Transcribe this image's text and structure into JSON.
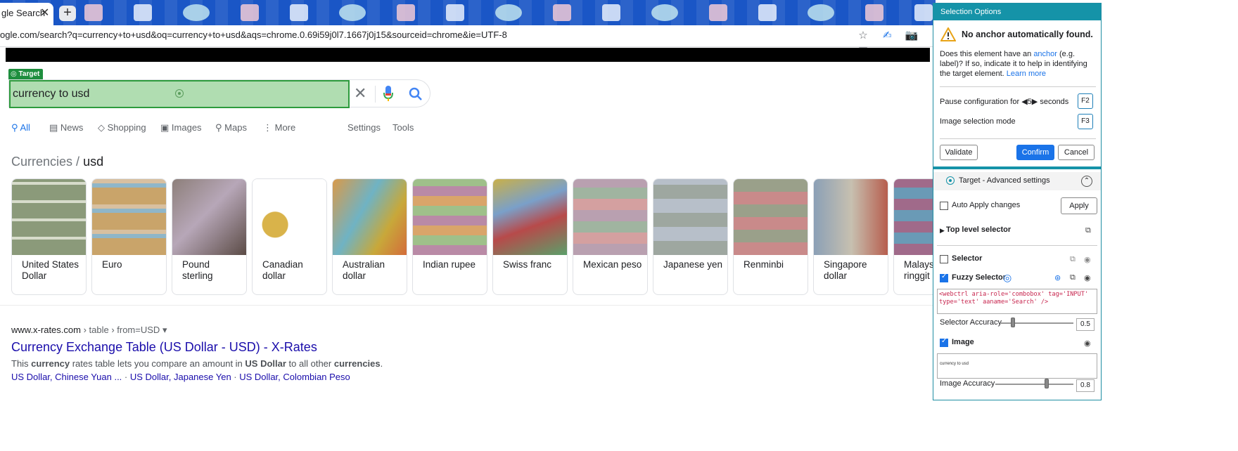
{
  "browser": {
    "tab_title": "gle Search",
    "tab_close": "✕",
    "new_tab": "+",
    "url": "ogle.com/search?q=currency+to+usd&oq=currency+to+usd&aqs=chrome.0.69i59j0l7.1667j0j15&sourceid=chrome&ie=UTF-8",
    "toolbar_icons": [
      "star-icon",
      "uipath-icon",
      "camera-icon",
      "extension-icon"
    ]
  },
  "search": {
    "target_tag": "Target",
    "query": "currency to usd",
    "clear": "✕"
  },
  "nav": {
    "tabs": [
      {
        "label": "All",
        "icon": "search-icon",
        "active": true
      },
      {
        "label": "News",
        "icon": "news-icon"
      },
      {
        "label": "Shopping",
        "icon": "tag-icon"
      },
      {
        "label": "Images",
        "icon": "image-icon"
      },
      {
        "label": "Maps",
        "icon": "pin-icon"
      },
      {
        "label": "More",
        "icon": "more-icon"
      }
    ],
    "settings": "Settings",
    "tools": "Tools"
  },
  "currencies": {
    "heading_prefix": "Currencies",
    "heading_sep": "/",
    "heading_term": "usd",
    "cards": [
      {
        "name": "United States Dollar",
        "color": "#8b9a7a"
      },
      {
        "name": "Euro",
        "color": "#c9a46a"
      },
      {
        "name": "Pound sterling",
        "color": "#8d7f7a"
      },
      {
        "name": "Canadian dollar",
        "color": "#d9b34a"
      },
      {
        "name": "Australian dollar",
        "color": "#d99a4a"
      },
      {
        "name": "Indian rupee",
        "color": "#b98aa6"
      },
      {
        "name": "Swiss franc",
        "color": "#c9b04a"
      },
      {
        "name": "Mexican peso",
        "color": "#b9a0b0"
      },
      {
        "name": "Japanese yen",
        "color": "#9ea7a0"
      },
      {
        "name": "Renminbi",
        "color": "#c98a8a"
      },
      {
        "name": "Singapore dollar",
        "color": "#8ba0b6"
      },
      {
        "name": "Malaysian ringgit",
        "color": "#a06a8a"
      }
    ]
  },
  "result": {
    "site": "www.x-rates.com",
    "crumb": " › table › from=USD",
    "dropdown": "▾",
    "title": "Currency Exchange Table (US Dollar - USD) - X-Rates",
    "snippet_parts": [
      "This ",
      "currency",
      " rates table lets you compare an amount in ",
      "US Dollar",
      " to all other ",
      "currencies",
      "."
    ],
    "links": [
      "US Dollar, Chinese Yuan ...",
      "US Dollar, Japanese Yen",
      "US Dollar, Colombian Peso"
    ],
    "link_sep": " · "
  },
  "panel": {
    "header": "Selection Options",
    "warning_title": "No anchor automatically found.",
    "warning_pre": "Does this element have an ",
    "warning_link": "anchor",
    "warning_mid": " (e.g. label)? If so, indicate it to help in identifying the target element. ",
    "learn_more": "Learn more",
    "pause_label": "Pause configuration for",
    "pause_value": "5",
    "pause_unit": "seconds",
    "pause_key": "F2",
    "image_mode_label": "Image selection mode",
    "image_mode_key": "F3",
    "validate": "Validate",
    "confirm": "Confirm",
    "cancel": "Cancel",
    "advanced_title": "Target - Advanced settings",
    "auto_apply": "Auto Apply changes",
    "apply": "Apply",
    "top_level": "Top level selector",
    "selector": "Selector",
    "fuzzy_selector": "Fuzzy Selector",
    "fuzzy_code": "<webctrl aria-role='combobox' tag='INPUT' type='text' aaname='Search' />",
    "selector_accuracy_label": "Selector Accuracy",
    "selector_accuracy": "0.5",
    "image_label": "Image",
    "image_preview": "currency to usd",
    "image_accuracy_label": "Image Accuracy",
    "image_accuracy": "0.8"
  }
}
